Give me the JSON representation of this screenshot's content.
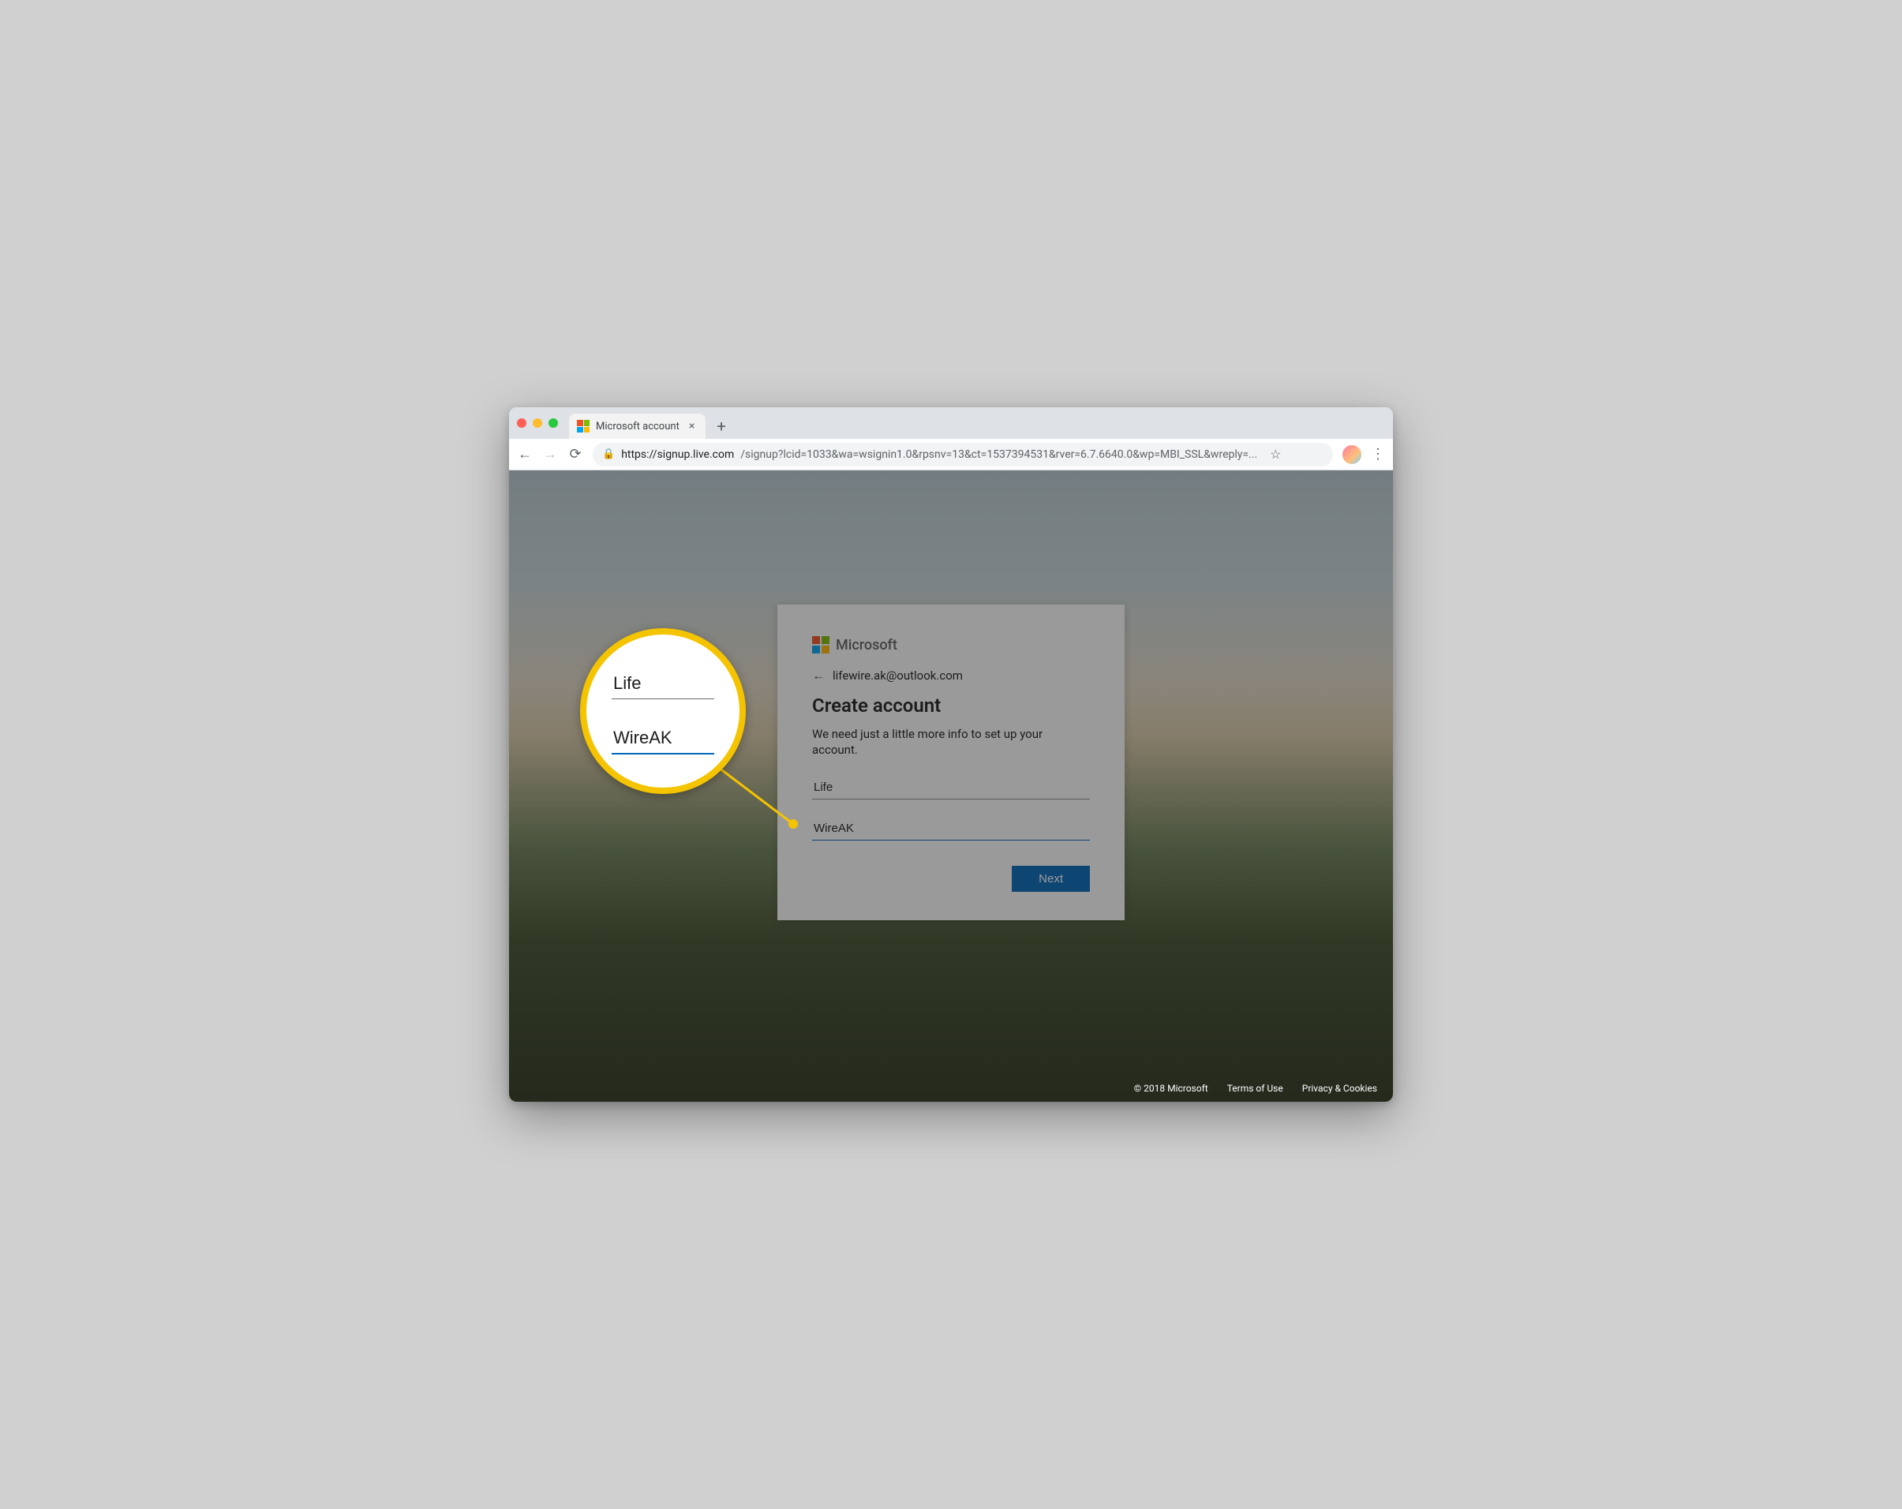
{
  "browser": {
    "tab_title": "Microsoft account",
    "url_host": "https://signup.live.com",
    "url_path": "/signup?lcid=1033&wa=wsignin1.0&rpsnv=13&ct=1537394531&rver=6.7.6640.0&wp=MBI_SSL&wreply=..."
  },
  "brand": {
    "name": "Microsoft"
  },
  "identity": {
    "email": "lifewire.ak@outlook.com"
  },
  "form": {
    "heading": "Create account",
    "subtext": "We need just a little more info to set up your account.",
    "first_name": "Life",
    "last_name": "WireAK",
    "next_label": "Next"
  },
  "footer": {
    "copyright": "© 2018 Microsoft",
    "terms": "Terms of Use",
    "privacy": "Privacy & Cookies"
  },
  "magnifier": {
    "first_name": "Life",
    "last_name": "WireAK"
  }
}
